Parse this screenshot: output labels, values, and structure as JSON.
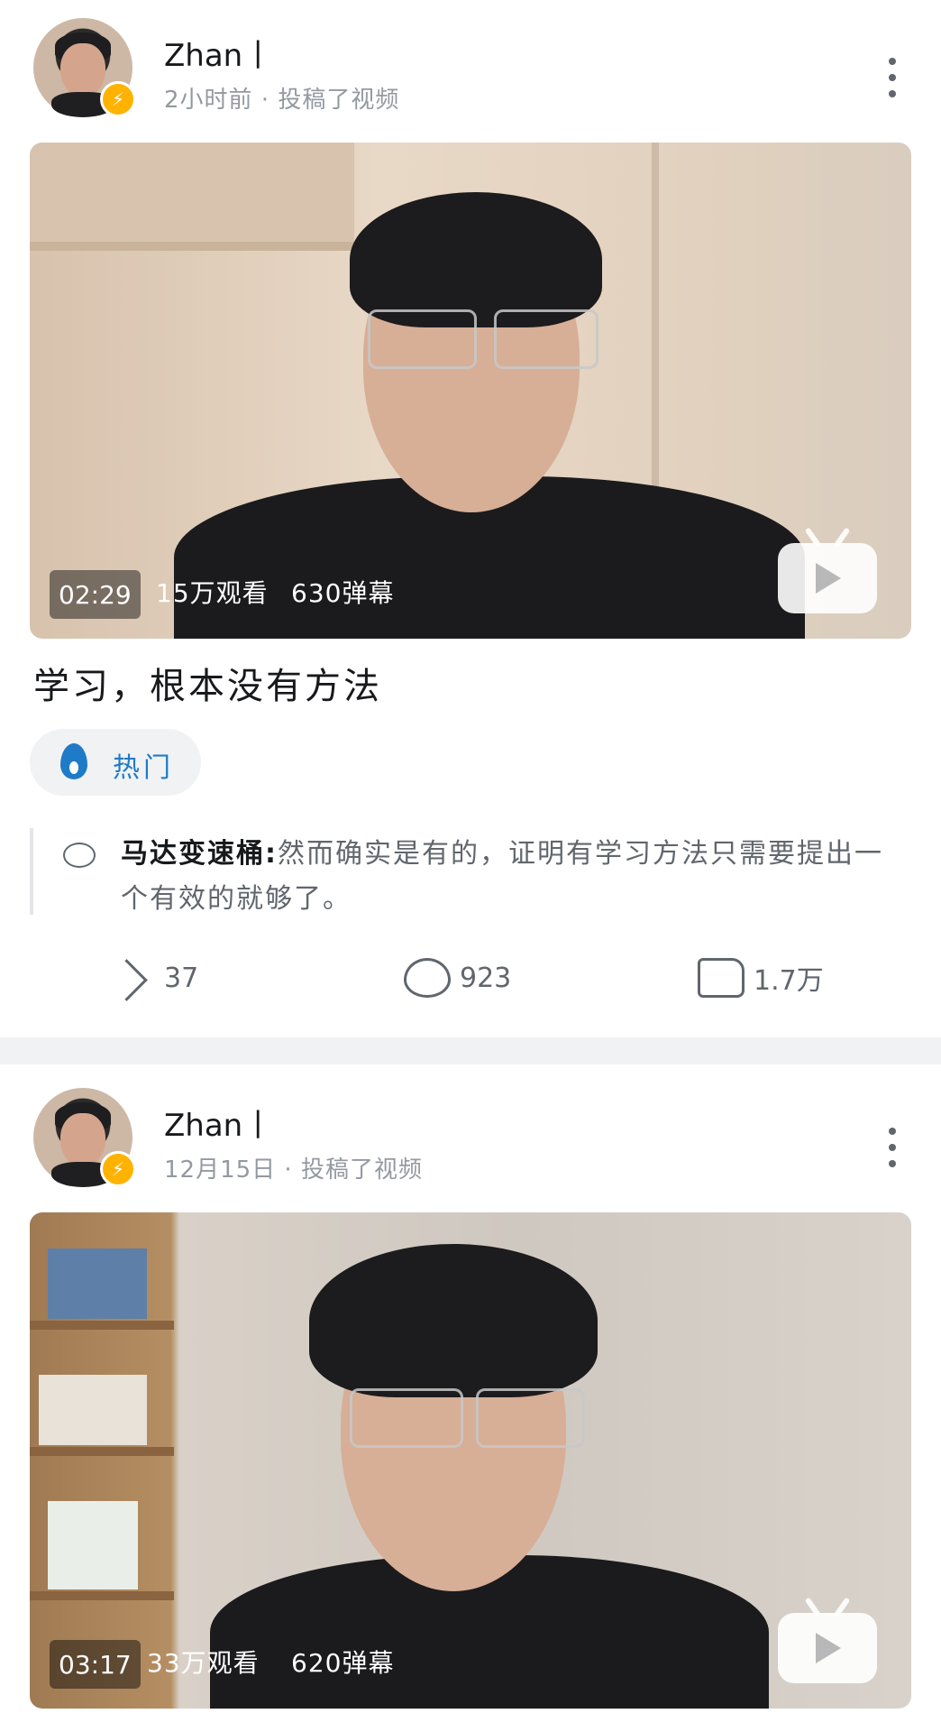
{
  "posts": [
    {
      "username": "Zhan丨",
      "meta": "2小时前 · 投稿了视频",
      "duration": "02:29",
      "views": "15万观看",
      "danmaku": "630弹幕",
      "title": "学习，根本没有方法",
      "tag": "热门",
      "top_comment": {
        "author": "马达变速桶:",
        "text": "然而确实是有的，证明有学习方法只需要提出一个有效的就够了。"
      },
      "share_count": "37",
      "comment_count": "923",
      "like_count": "1.7万"
    },
    {
      "username": "Zhan丨",
      "meta": "12月15日 · 投稿了视频",
      "duration": "03:17",
      "views": "33万观看",
      "danmaku": "620弹幕"
    }
  ],
  "colors": {
    "accent_blue": "#1f7bc7",
    "badge_yellow": "#ffb300",
    "text_gray": "#61666d",
    "meta_gray": "#9499a0"
  },
  "icons": [
    "lightning-badge-icon",
    "more-vertical-icon",
    "tv-play-icon",
    "flame-icon",
    "comment-bubble-icon",
    "share-icon",
    "reply-icon",
    "like-icon"
  ]
}
